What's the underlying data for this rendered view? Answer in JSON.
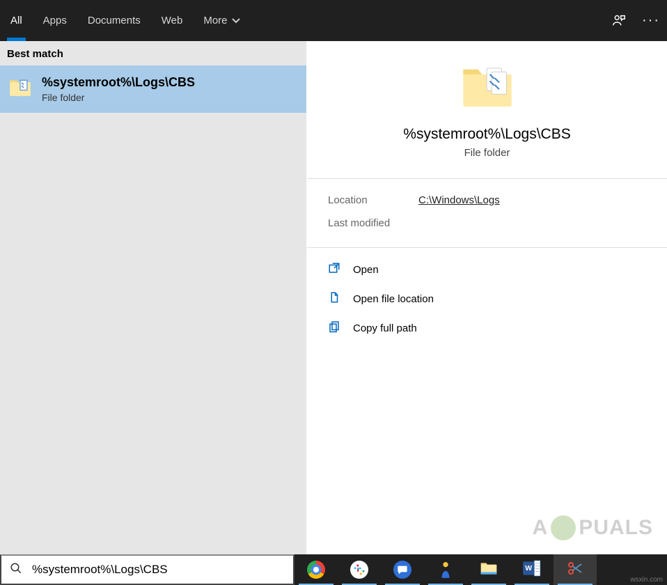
{
  "tabs": {
    "all": "All",
    "apps": "Apps",
    "documents": "Documents",
    "web": "Web",
    "more": "More"
  },
  "left": {
    "section": "Best match",
    "result": {
      "title": "%systemroot%\\Logs\\CBS",
      "subtitle": "File folder"
    }
  },
  "preview": {
    "title": "%systemroot%\\Logs\\CBS",
    "subtitle": "File folder"
  },
  "meta": {
    "location_label": "Location",
    "location_value": "C:\\Windows\\Logs",
    "modified_label": "Last modified",
    "modified_value": ""
  },
  "actions": {
    "open": "Open",
    "open_location": "Open file location",
    "copy_path": "Copy full path"
  },
  "search": {
    "query": "%systemroot%\\Logs\\CBS"
  },
  "watermark": {
    "prefix": "A",
    "suffix": "PUALS"
  },
  "corner": "wsxin.com"
}
